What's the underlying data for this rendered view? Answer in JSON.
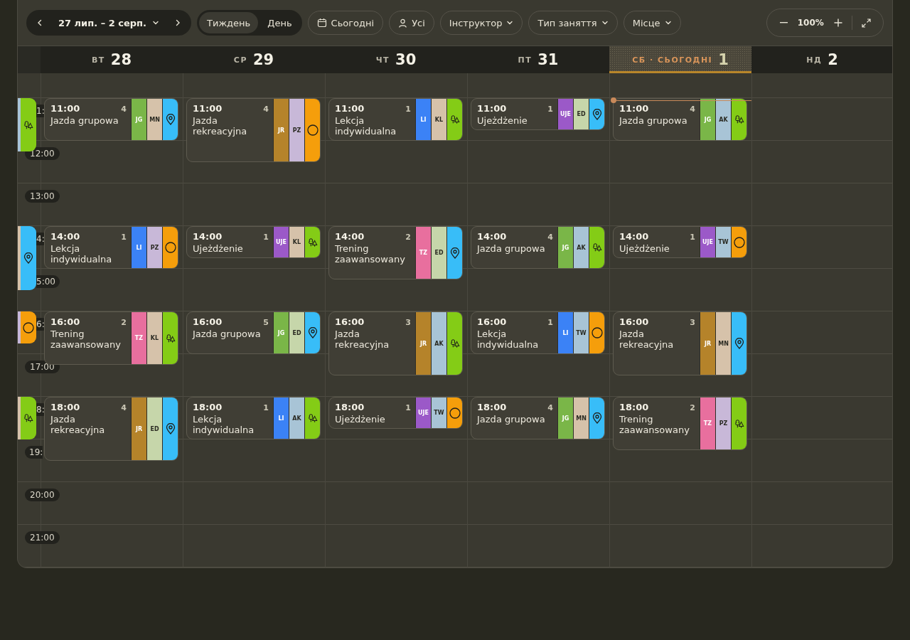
{
  "toolbar": {
    "date_range": "27 лип. – 2 серп.",
    "views": [
      {
        "label": "Тиждень",
        "selected": true
      },
      {
        "label": "День",
        "selected": false
      }
    ],
    "today_button": "Сьогодні",
    "people_filter": "Усі",
    "filters": [
      "Інструктор",
      "Тип заняття",
      "Місце"
    ],
    "zoom": "100%"
  },
  "days": [
    {
      "weekday": "ВТ",
      "date": "28",
      "today": false
    },
    {
      "weekday": "СР",
      "date": "29",
      "today": false
    },
    {
      "weekday": "ЧТ",
      "date": "30",
      "today": false
    },
    {
      "weekday": "ПТ",
      "date": "31",
      "today": false
    },
    {
      "weekday": "СБ · СЬОГОДНІ",
      "date": "1",
      "today": true
    },
    {
      "weekday": "НД",
      "date": "2",
      "today": false
    }
  ],
  "hours": [
    {
      "label": {
        "text": "1:",
        "cut_left": true
      },
      "previous_day_event": {
        "kind": "long",
        "instructor": {
          "color": "#a8c4d6"
        },
        "location": {
          "kind": "trees",
          "color": "#84cc16"
        }
      },
      "events": [
        {
          "time": "11:00",
          "count": "4",
          "title": "Jazda grupowa",
          "kind": "medium",
          "type": {
            "code": "JG",
            "color": "#7ab648"
          },
          "instructor": {
            "code": "MN",
            "color": "#d6c2aa"
          },
          "location": {
            "kind": "pin",
            "color": "#38bdf8"
          }
        },
        {
          "time": "11:00",
          "count": "4",
          "title": "Jazda rekreacyjna",
          "kind": "xl",
          "type": {
            "code": "JR",
            "color": "#b5832a"
          },
          "instructor": {
            "code": "PZ",
            "color": "#c8b8d8"
          },
          "location": {
            "kind": "circle",
            "color": "#f59e0b"
          }
        },
        {
          "time": "11:00",
          "count": "1",
          "title": "Lekcja indywidualna",
          "kind": "medium",
          "type": {
            "code": "LI",
            "color": "#3b82f6"
          },
          "instructor": {
            "code": "KL",
            "color": "#d6c2aa"
          },
          "location": {
            "kind": "trees",
            "color": "#84cc16"
          }
        },
        {
          "time": "11:00",
          "count": "1",
          "title": "Ujeżdżenie",
          "kind": "short",
          "type": {
            "code": "UJE",
            "color": "#9b59c8"
          },
          "instructor": {
            "code": "ED",
            "color": "#c6d6aa"
          },
          "location": {
            "kind": "pin",
            "color": "#38bdf8"
          }
        },
        {
          "time": "11:00",
          "count": "4",
          "title": "Jazda grupowa",
          "kind": "medium",
          "type": {
            "code": "JG",
            "color": "#7ab648"
          },
          "instructor": {
            "code": "AK",
            "color": "#a8c4d6"
          },
          "location": {
            "kind": "trees",
            "color": "#84cc16"
          }
        }
      ]
    },
    {
      "label": {
        "text": "12:00"
      }
    },
    {
      "label": {
        "text": "13:00"
      }
    },
    {
      "label": {
        "text": "4:",
        "cut_left": true
      },
      "previous_day_event": {
        "kind": "xl",
        "instructor": {
          "color": "#d6c2aa"
        },
        "location": {
          "kind": "pin",
          "color": "#38bdf8"
        }
      },
      "events": [
        {
          "time": "14:00",
          "count": "1",
          "title": "Lekcja indywidualna",
          "kind": "medium",
          "type": {
            "code": "LI",
            "color": "#3b82f6"
          },
          "instructor": {
            "code": "PZ",
            "color": "#c8b8d8"
          },
          "location": {
            "kind": "circle",
            "color": "#f59e0b"
          }
        },
        {
          "time": "14:00",
          "count": "1",
          "title": "Ujeżdżenie",
          "kind": "short",
          "type": {
            "code": "UJE",
            "color": "#9b59c8"
          },
          "instructor": {
            "code": "KL",
            "color": "#d6c2aa"
          },
          "location": {
            "kind": "trees",
            "color": "#84cc16"
          }
        },
        {
          "time": "14:00",
          "count": "2",
          "title": "Trening zaawansowany",
          "kind": "long",
          "type": {
            "code": "TZ",
            "color": "#e86f9e"
          },
          "instructor": {
            "code": "ED",
            "color": "#c6d6aa"
          },
          "location": {
            "kind": "pin",
            "color": "#38bdf8"
          }
        },
        {
          "time": "14:00",
          "count": "4",
          "title": "Jazda grupowa",
          "kind": "medium",
          "type": {
            "code": "JG",
            "color": "#7ab648"
          },
          "instructor": {
            "code": "AK",
            "color": "#a8c4d6"
          },
          "location": {
            "kind": "trees",
            "color": "#84cc16"
          }
        },
        {
          "time": "14:00",
          "count": "1",
          "title": "Ujeżdżenie",
          "kind": "short",
          "type": {
            "code": "UJE",
            "color": "#9b59c8"
          },
          "instructor": {
            "code": "TW",
            "color": "#a8c4d6"
          },
          "location": {
            "kind": "circle",
            "color": "#f59e0b"
          }
        }
      ]
    },
    {
      "label": {
        "text": "5:00",
        "cut_left": true
      }
    },
    {
      "label": {
        "text": "6:",
        "cut_left": true
      },
      "previous_day_event": {
        "kind": "short",
        "instructor": {
          "color": "#c8b8d8"
        },
        "location": {
          "kind": "circle",
          "color": "#f59e0b"
        }
      },
      "events": [
        {
          "time": "16:00",
          "count": "2",
          "title": "Trening zaawansowany",
          "kind": "long",
          "type": {
            "code": "TZ",
            "color": "#e86f9e"
          },
          "instructor": {
            "code": "KL",
            "color": "#d6c2aa"
          },
          "location": {
            "kind": "trees",
            "color": "#84cc16"
          }
        },
        {
          "time": "16:00",
          "count": "5",
          "title": "Jazda grupowa",
          "kind": "medium",
          "type": {
            "code": "JG",
            "color": "#7ab648"
          },
          "instructor": {
            "code": "ED",
            "color": "#c6d6aa"
          },
          "location": {
            "kind": "pin",
            "color": "#38bdf8"
          }
        },
        {
          "time": "16:00",
          "count": "3",
          "title": "Jazda rekreacyjna",
          "kind": "xl",
          "type": {
            "code": "JR",
            "color": "#b5832a"
          },
          "instructor": {
            "code": "AK",
            "color": "#a8c4d6"
          },
          "location": {
            "kind": "trees",
            "color": "#84cc16"
          }
        },
        {
          "time": "16:00",
          "count": "1",
          "title": "Lekcja indywidualna",
          "kind": "medium",
          "type": {
            "code": "LI",
            "color": "#3b82f6"
          },
          "instructor": {
            "code": "TW",
            "color": "#a8c4d6"
          },
          "location": {
            "kind": "circle",
            "color": "#f59e0b"
          }
        },
        {
          "time": "16:00",
          "count": "3",
          "title": "Jazda rekreacyjna",
          "kind": "xl",
          "type": {
            "code": "JR",
            "color": "#b5832a"
          },
          "instructor": {
            "code": "MN",
            "color": "#d6c2aa"
          },
          "location": {
            "kind": "pin",
            "color": "#38bdf8"
          }
        }
      ]
    },
    {
      "label": {
        "text": "17:00"
      }
    },
    {
      "label": {
        "text": "8:",
        "cut_left": true
      },
      "previous_day_event": {
        "kind": "medium",
        "instructor": {
          "color": "#d6c2aa"
        },
        "location": {
          "kind": "trees",
          "color": "#84cc16"
        }
      },
      "events": [
        {
          "time": "18:00",
          "count": "4",
          "title": "Jazda rekreacyjna",
          "kind": "xl",
          "type": {
            "code": "JR",
            "color": "#b5832a"
          },
          "instructor": {
            "code": "ED",
            "color": "#c6d6aa"
          },
          "location": {
            "kind": "pin",
            "color": "#38bdf8"
          }
        },
        {
          "time": "18:00",
          "count": "1",
          "title": "Lekcja indywidualna",
          "kind": "medium",
          "type": {
            "code": "LI",
            "color": "#3b82f6"
          },
          "instructor": {
            "code": "AK",
            "color": "#a8c4d6"
          },
          "location": {
            "kind": "trees",
            "color": "#84cc16"
          }
        },
        {
          "time": "18:00",
          "count": "1",
          "title": "Ujeżdżenie",
          "kind": "short",
          "type": {
            "code": "UJE",
            "color": "#9b59c8"
          },
          "instructor": {
            "code": "TW",
            "color": "#a8c4d6"
          },
          "location": {
            "kind": "circle",
            "color": "#f59e0b"
          }
        },
        {
          "time": "18:00",
          "count": "4",
          "title": "Jazda grupowa",
          "kind": "medium",
          "type": {
            "code": "JG",
            "color": "#7ab648"
          },
          "instructor": {
            "code": "MN",
            "color": "#d6c2aa"
          },
          "location": {
            "kind": "pin",
            "color": "#38bdf8"
          }
        },
        {
          "time": "18:00",
          "count": "2",
          "title": "Trening zaawansowany",
          "kind": "long",
          "type": {
            "code": "TZ",
            "color": "#e86f9e"
          },
          "instructor": {
            "code": "PZ",
            "color": "#c8b8d8"
          },
          "location": {
            "kind": "trees",
            "color": "#84cc16"
          }
        }
      ]
    },
    {
      "label": {
        "text": "19:",
        "cut_right": true
      }
    },
    {
      "label": {
        "text": "20:00"
      }
    },
    {
      "label": {
        "text": "21:00"
      }
    }
  ]
}
